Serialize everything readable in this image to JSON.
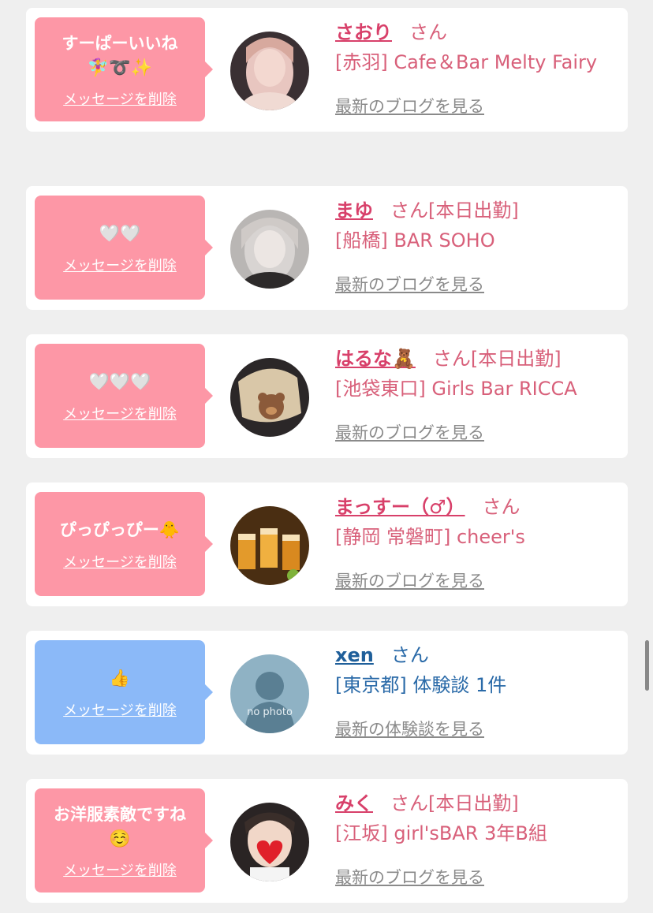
{
  "delete_label": "メッセージを削除",
  "san": "さん",
  "cards": [
    {
      "message": "すーぱーいいね",
      "message_emoji": "🧚‍♀️➰✨",
      "name": "さおり",
      "status": "",
      "shop": "[赤羽] Cafe＆Bar Melty Fairy",
      "link": "最新のブログを見る",
      "avatar": "pink-portrait",
      "theme": "pink"
    },
    {
      "message": "🤍🤍",
      "message_emoji": "",
      "name": "まゆ",
      "status": "[本日出勤]",
      "shop": "[船橋] BAR SOHO",
      "link": "最新のブログを見る",
      "avatar": "gray-portrait",
      "theme": "pink"
    },
    {
      "message": "🤍🤍🤍",
      "message_emoji": "",
      "name": "はるな🧸",
      "status": "[本日出勤]",
      "shop": "[池袋東口] Girls Bar RICCA",
      "link": "最新のブログを見る",
      "avatar": "dark-portrait",
      "theme": "pink"
    },
    {
      "message": "ぴっぴっぴー🐥",
      "message_emoji": "",
      "name": "まっすー（♂）",
      "status": "",
      "shop": "[静岡 常磐町] cheer's",
      "link": "最新のブログを見る",
      "avatar": "drinks-photo",
      "theme": "pink"
    },
    {
      "message": "👍",
      "message_emoji": "",
      "name": "xen",
      "status": "",
      "shop": "[東京都] 体験談 1件",
      "link": "最新の体験談を見る",
      "avatar": "no-photo",
      "avatar_text": "no photo",
      "theme": "blue"
    },
    {
      "message": "お洋服素敵ですね",
      "message_emoji": "☺️",
      "name": "みく",
      "status": "[本日出勤]",
      "shop": "[江坂] girl'sBAR 3年B組",
      "link": "最新のブログを見る",
      "avatar": "heart-portrait",
      "theme": "pink"
    }
  ],
  "colors": {
    "pink_bubble": "#fd97a6",
    "blue_bubble": "#8bb9f8",
    "name_pink": "#d8406a",
    "name_blue": "#1f5f9a",
    "background": "#efefef"
  }
}
